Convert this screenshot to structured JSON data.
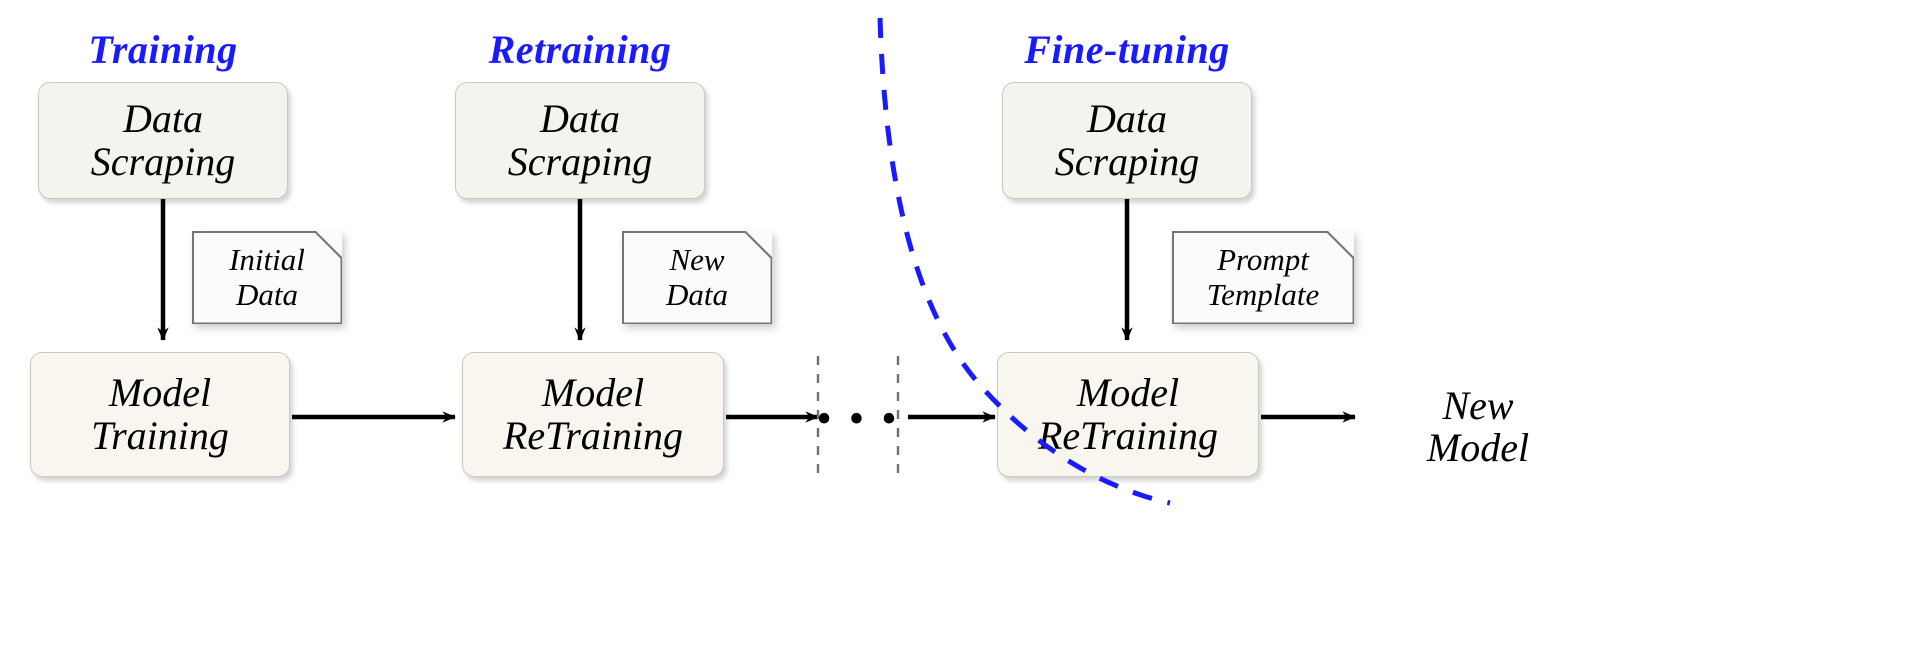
{
  "diagram": {
    "title": "LLM lifecycle: Training, Retraining, Fine-tuning",
    "accent_color": "#1a1aff",
    "box_fill_top": "#f4f4ee",
    "box_fill_bottom": "#f9f6f0",
    "arrow_color": "#000000",
    "divider_color": "#707070"
  },
  "phases": [
    {
      "id": "training",
      "label": "Training"
    },
    {
      "id": "retraining",
      "label": "Retraining"
    },
    {
      "id": "finetuning",
      "label": "Fine-tuning"
    }
  ],
  "nodes": {
    "scrape1": {
      "line1": "Data",
      "line2": "Scraping"
    },
    "scrape2": {
      "line1": "Data",
      "line2": "Scraping"
    },
    "scrape3": {
      "line1": "Data",
      "line2": "Scraping"
    },
    "model1": {
      "line1": "Model",
      "line2": "Training"
    },
    "model2": {
      "line1": "Model",
      "line2": "ReTraining"
    },
    "model3": {
      "line1": "Model",
      "line2": "ReTraining"
    },
    "output": {
      "line1": "New",
      "line2": "Model"
    }
  },
  "notes": [
    {
      "id": "initial-data",
      "line1": "Initial",
      "line2": "Data"
    },
    {
      "id": "new-data",
      "line1": "New",
      "line2": "Data"
    },
    {
      "id": "prompt-template",
      "line1": "Prompt",
      "line2": "Template"
    }
  ],
  "separator": {
    "ellipsis": "• • •"
  }
}
